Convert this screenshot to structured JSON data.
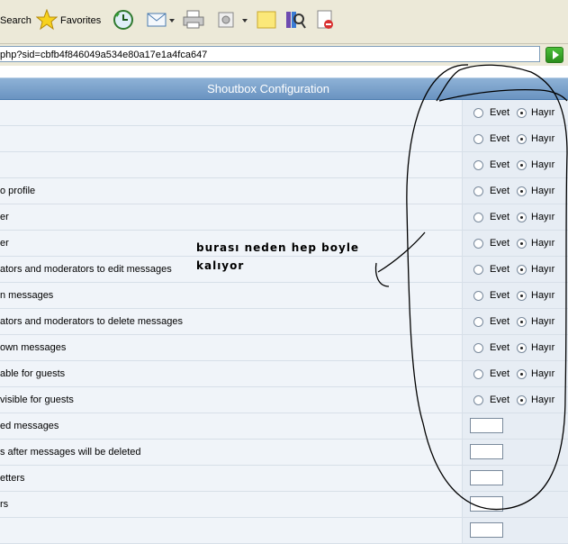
{
  "toolbar": {
    "search_label": "Search",
    "favorites_label": "Favorites"
  },
  "address": {
    "url": "php?sid=cbfb4f846049a534e80a17e1a4fca647"
  },
  "header": {
    "title": "Shoutbox Configuration"
  },
  "options": {
    "yes": "Evet",
    "no": "Hayır"
  },
  "rows": [
    {
      "label": "",
      "type": "radio",
      "selected": "no"
    },
    {
      "label": "",
      "type": "radio",
      "selected": "no"
    },
    {
      "label": "",
      "type": "radio",
      "selected": "no"
    },
    {
      "label": "o profile",
      "type": "radio",
      "selected": "no"
    },
    {
      "label": "er",
      "type": "radio",
      "selected": "no"
    },
    {
      "label": "er",
      "type": "radio",
      "selected": "no"
    },
    {
      "label": "ators and moderators to edit messages",
      "type": "radio",
      "selected": "no"
    },
    {
      "label": "n messages",
      "type": "radio",
      "selected": "no"
    },
    {
      "label": "ators and moderators to delete messages",
      "type": "radio",
      "selected": "no"
    },
    {
      "label": "own messages",
      "type": "radio",
      "selected": "no"
    },
    {
      "label": "able for guests",
      "type": "radio",
      "selected": "no"
    },
    {
      "label": "visible for guests",
      "type": "radio",
      "selected": "no"
    },
    {
      "label": "ed messages",
      "type": "text",
      "value": ""
    },
    {
      "label": "s after messages will be deleted",
      "type": "text",
      "value": ""
    },
    {
      "label": "etters",
      "type": "text",
      "value": ""
    },
    {
      "label": "rs",
      "type": "text",
      "value": ""
    },
    {
      "label": "",
      "type": "text",
      "value": ""
    }
  ],
  "annotation": {
    "line1": "burası neden hep boyle",
    "line2": "kalıyor"
  }
}
